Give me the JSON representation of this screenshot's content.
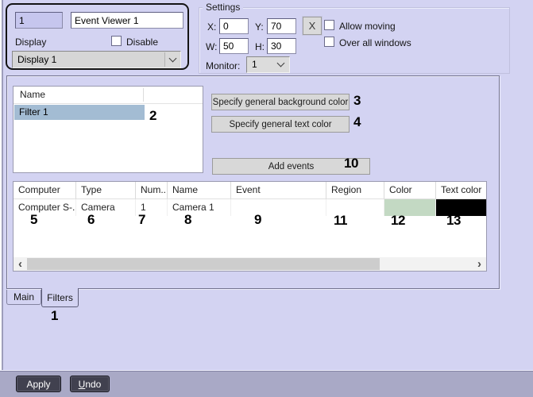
{
  "header": {
    "id_value": "1",
    "name_value": "Event Viewer 1",
    "display_label": "Display",
    "disable_label": "Disable",
    "display_select_value": "Display 1"
  },
  "settings": {
    "title": "Settings",
    "x_label": "X:",
    "x_value": "0",
    "y_label": "Y:",
    "y_value": "70",
    "w_label": "W:",
    "w_value": "50",
    "h_label": "H:",
    "h_value": "30",
    "clear_button_label": "X",
    "allow_moving_label": "Allow moving",
    "over_all_windows_label": "Over all windows",
    "monitor_label": "Monitor:",
    "monitor_value": "1"
  },
  "filters_panel": {
    "list": {
      "header": "Name",
      "selected_row": "Filter 1"
    },
    "buttons": {
      "bg_color": "Specify general background color",
      "text_color": "Specify general text color",
      "add_events": "Add events"
    },
    "table": {
      "columns": [
        "Computer",
        "Type",
        "Num...",
        "Name",
        "Event",
        "Region",
        "Color",
        "Text color"
      ],
      "row": {
        "computer": "Computer S-..",
        "type": "Camera",
        "num": "1",
        "name": "Camera 1",
        "event": "",
        "region": "",
        "color_swatch": "#c3d9c3",
        "text_color_swatch": "#000000"
      }
    }
  },
  "tabs": {
    "main": "Main",
    "filters": "Filters"
  },
  "footer": {
    "apply": "Apply",
    "undo_first": "U",
    "undo_rest": "ndo"
  },
  "annotations": {
    "n1": "1",
    "n2": "2",
    "n3": "3",
    "n4": "4",
    "n5": "5",
    "n6": "6",
    "n7": "7",
    "n8": "8",
    "n9": "9",
    "n10": "10",
    "n11": "11",
    "n12": "12",
    "n13": "13"
  },
  "colors": {
    "background": "#d3d3f2",
    "selection": "#a3bcd3",
    "footer_bar": "#a9a9c6",
    "swatch_green": "#c3d9c3",
    "swatch_black": "#000000"
  }
}
